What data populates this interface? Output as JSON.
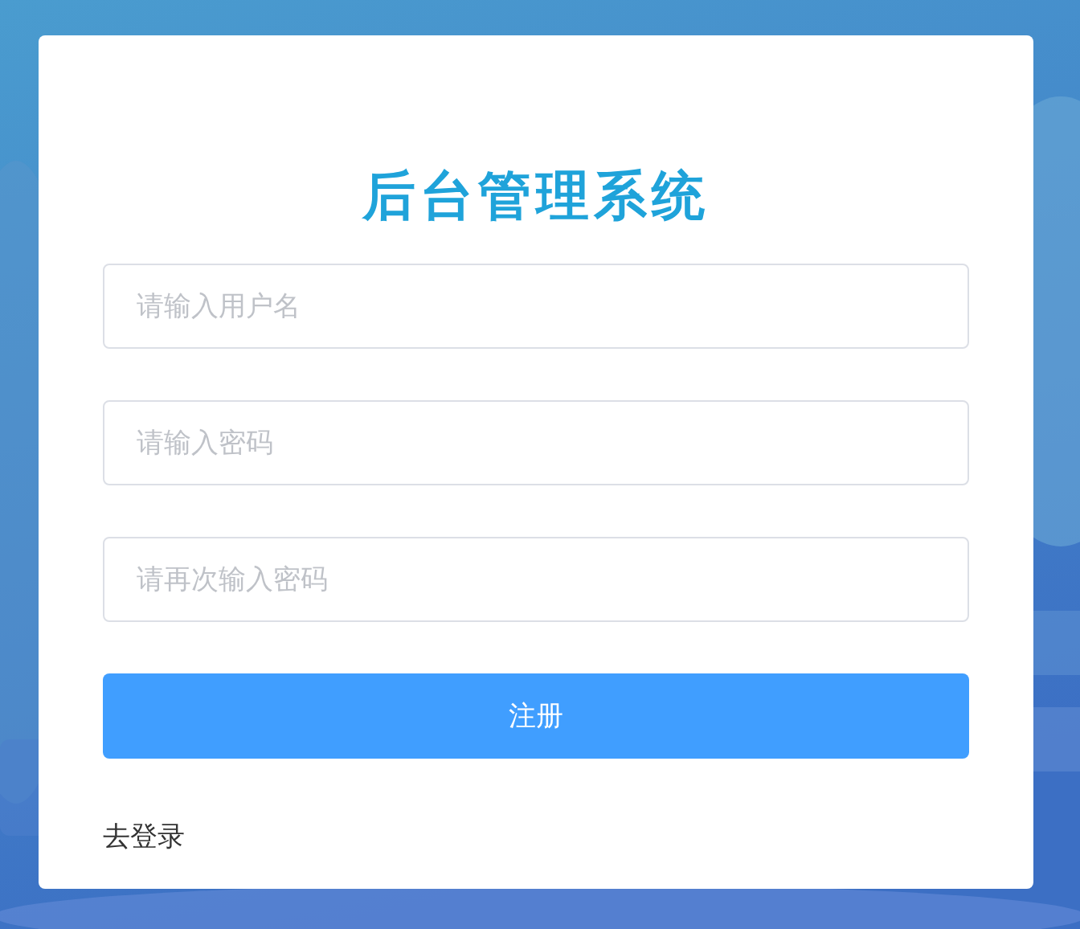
{
  "title": "后台管理系统",
  "fields": [
    {
      "placeholder": "请输入用户名"
    },
    {
      "placeholder": "请输入密码"
    },
    {
      "placeholder": "请再次输入密码"
    }
  ],
  "submit_button": "注册",
  "login_link": "去登录"
}
